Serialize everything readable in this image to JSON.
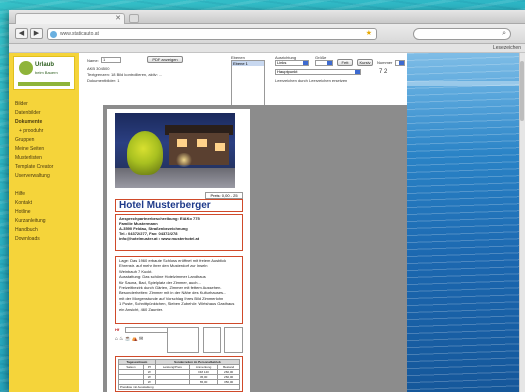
{
  "browser": {
    "url": "www.staticauto.at",
    "bookmarks_label": "Lesezeichen"
  },
  "sidebar": {
    "logo_name": "Urlaub",
    "logo_tagline": "beim Bauern",
    "items": [
      {
        "label": "Bilder"
      },
      {
        "label": "Datenbilder"
      },
      {
        "label": "Dokumente"
      },
      {
        "label": "+ prooduhr"
      },
      {
        "label": "Gruppen"
      },
      {
        "label": "Meine Seiten"
      },
      {
        "label": "Musterlisten"
      },
      {
        "label": "Template Creator"
      },
      {
        "label": "Userverwaltung"
      }
    ],
    "items2": [
      {
        "label": "Hilfe"
      },
      {
        "label": "Kontakt"
      },
      {
        "label": "Hotline"
      },
      {
        "label": "Kurzanleitung"
      },
      {
        "label": "Handbuch"
      },
      {
        "label": "Downloads"
      }
    ]
  },
  "controls": {
    "name_label": "Name:",
    "name_value": "1",
    "pdf_button": "PDF anzeigen",
    "info_lines": [
      "AKB 304500",
      "Textgrenzen: 18 Bild kontrollieren, aktiv: ...",
      "Dokumentbilder: 1"
    ],
    "ebenen_label": "Ebenen",
    "ebenen_option": "Ebene 1",
    "ausrichtung_label": "Ausrichtung",
    "ausrichtung_value": "Links",
    "grosse_label": "Größe",
    "fett_button": "Fett",
    "kursiv_button": "Kursiv",
    "nummer_label": "Nummer",
    "style_select": "Hauptpunkt",
    "note_text": "Leerzeichen durch Leerzeichen ersetzen",
    "counter": "7 2"
  },
  "sheet": {
    "preis_label": "Preis: 0,00 - 25",
    "hotel_name": "Hotel Musterberger",
    "address_lines": [
      "Ansprechpartnerbeschreibung: EiAKo 775",
      "Familie Mustermann",
      "A-3590 Feldau, Straßenbezeichnung",
      "Tel.: 04372/277, Fax: 04372/278",
      "info@hotelmuster.at • www.musterhotel.at"
    ],
    "description_lines": [
      "Lage: Das 1960 erbaute Schloss eröffnet mit freiem Ausblick",
      "Ehrenstr. auf mehr ihrer den Musterdorf zur Inseln",
      "Weinbauh 7 Kuckt.",
      "Ausstattung: Das schöne Hotelzimmer Landhaus",
      "für Sauna, Bad, Spielplatz der Zimmer, auch...",
      "Freizeitbezirk durch Gärten, Zimmer mit fettem Aussehen.",
      "Besonderheiten: Zimmer mit in der Nähe des Kulturhauses...",
      "mit der Morgenstunde auf Vorschlag Ihres Bild Zimmerlohn",
      "1 Puste, Schnittpünktchen, Sieben Zubehör: Wirtshaus Gasthaus",
      "ein Ansicht, 460 Zaunter."
    ],
    "field_label": "Hf",
    "icons": "⌂♨☕⛺✉",
    "table_header": "Tageszeitraum",
    "table_header2": "Sonderzeiten im Personalbetrieb",
    "table_rows": [
      [
        "Saison",
        "Pf",
        "Leistung/Preis",
        "Anmerkung",
        "Bestand"
      ],
      [
        "",
        "W",
        "",
        "DM 140",
        "260,00"
      ],
      [
        "",
        "W",
        "",
        "45,00",
        "260,00"
      ],
      [
        "",
        "W",
        "",
        "65,00",
        "350,00"
      ],
      [
        "Preisliste mit Ausstattung",
        "",
        "",
        "",
        ""
      ]
    ]
  }
}
